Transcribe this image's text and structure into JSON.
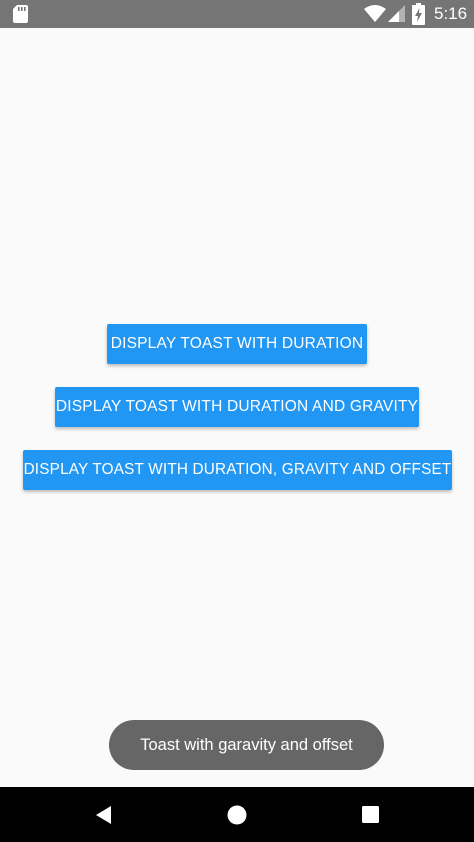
{
  "status_bar": {
    "time": "5:16",
    "icons": [
      "sd-card-icon",
      "wifi-icon",
      "cell-signal-icon",
      "battery-charging-icon"
    ]
  },
  "main": {
    "buttons": [
      {
        "label": "DISPLAY TOAST WITH DURATION"
      },
      {
        "label": "DISPLAY TOAST WITH DURATION AND GRAVITY"
      },
      {
        "label": "DISPLAY TOAST WITH DURATION, GRAVITY AND OFFSET"
      }
    ],
    "toast": {
      "message": "Toast with garavity and offset"
    }
  },
  "nav_bar": {
    "icons": [
      "back-icon",
      "home-icon",
      "recents-icon"
    ]
  },
  "colors": {
    "status_bar": "#757575",
    "background": "#fafafa",
    "button": "#2196f3",
    "toast": "#666666",
    "nav_bar": "#000000"
  }
}
